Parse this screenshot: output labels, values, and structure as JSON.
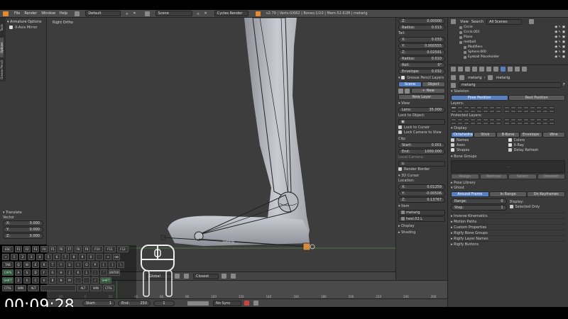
{
  "menu": {
    "items": [
      "File",
      "Render",
      "Window",
      "Help"
    ],
    "layout": "Default",
    "scene": "Scene",
    "engine": "Cycles Render",
    "stats": "v2.79 | Verts:0/682 | Bones:1/10 | Mem:52.61M | metarig"
  },
  "left_tabs": [
    "Tools",
    "Options",
    "Grease Pencil"
  ],
  "armature_options": {
    "title": "Armature Options",
    "xmirror": "X-Axis Mirror"
  },
  "viewport": {
    "view_label": "Right Ortho",
    "bone_label": "metarig"
  },
  "translate": {
    "title": "Translate",
    "vector_label": "Vector",
    "x_label": "X:",
    "x": "0.000",
    "y_label": "Y:",
    "y": "0.000",
    "z_label": "Z:",
    "z": "0.000",
    "constraint_label": "Constraint Axis"
  },
  "keyboard": {
    "rows": [
      [
        "ESC",
        "F1",
        "F2",
        "F3",
        "F4",
        "F5",
        "F6",
        "F7",
        "F8",
        "F9",
        "F10",
        "F11",
        "F12"
      ],
      [
        "~",
        "1",
        "2",
        "3",
        "4",
        "5",
        "6",
        "7",
        "8",
        "9",
        "0",
        "-",
        "+",
        "⌫"
      ],
      [
        "TAB",
        "Q",
        "W",
        "E",
        "R",
        "T",
        "Y",
        "U",
        "I",
        "O",
        "P",
        "[",
        "]",
        "\\"
      ],
      [
        "CAPS",
        "A",
        "S",
        "D",
        "F",
        "G",
        "H",
        "J",
        "K",
        "L",
        ";",
        "'",
        "ENTER"
      ],
      [
        "SHIFT",
        "Z",
        "X",
        "C",
        "V",
        "B",
        "N",
        "M",
        ",",
        ".",
        "/",
        "SHIFT"
      ],
      [
        "CTRL",
        "WIN",
        "ALT",
        "",
        "ALT",
        "WIN",
        "CTRL"
      ]
    ]
  },
  "header3d": {
    "pivot": "Global",
    "snap": "Closest"
  },
  "timeline": {
    "ticks": [
      "-20",
      "0",
      "20",
      "40",
      "60",
      "80",
      "100",
      "120",
      "140",
      "160",
      "180",
      "200",
      "220",
      "240",
      "260"
    ],
    "start_label": "Start:",
    "start": "1",
    "end_label": "End:",
    "end": "250",
    "frame": "1",
    "sync": "No Sync"
  },
  "timer": "00:09:28",
  "npanel": {
    "top_fields": [
      {
        "label": "Z:",
        "value": "0.00000"
      },
      {
        "label": "Radius:",
        "value": "0.013"
      },
      {
        "label": "Tail:",
        "value": ""
      },
      {
        "label": "X:",
        "value": "0.033"
      },
      {
        "label": "Y:",
        "value": "0.000555"
      },
      {
        "label": "Z:",
        "value": "0.02591"
      },
      {
        "label": "Radius:",
        "value": "0.010"
      },
      {
        "label": "Roll:",
        "value": "0°"
      },
      {
        "label": "Envelope:",
        "value": "0.032"
      }
    ],
    "grease_pencil": "Grease Pencil Layers",
    "gp_scene": "Scene",
    "gp_object": "Object",
    "gp_new": "New",
    "gp_new_layer": "New Layer",
    "view": "View",
    "lens_label": "Lens:",
    "lens": "35.000",
    "lock_object": "Lock to Object:",
    "lock_cursor": "Lock to Cursor",
    "lock_camera": "Lock Camera to View",
    "clip": "Clip:",
    "clip_start_label": "Start:",
    "clip_start": "0.001",
    "clip_end_label": "End:",
    "clip_end": "1000.000",
    "local_camera": "Local Camera:",
    "render_border": "Render Border",
    "cursor3d": "3D Cursor",
    "location": "Location:",
    "cx_label": "X:",
    "cx": "0.01259",
    "cy_label": "Y:",
    "cy": "-0.00506",
    "cz_label": "Z:",
    "cz": "0.13767",
    "item": "Item",
    "item_name": "metarig",
    "item_bone": "heel.02.L",
    "display": "Display",
    "shading": "Shading"
  },
  "outliner": {
    "view": "View",
    "search": "Search",
    "scenes": "All Scenes",
    "items": [
      "Circle",
      "Circle.001",
      "Plane",
      "metball",
      "Modifiers",
      "Sphere.000",
      "Eyeball Placeholder"
    ]
  },
  "props": {
    "breadcrumb_obj": "metarig",
    "breadcrumb_bone": "metarig",
    "name": "metarig",
    "skeleton": "Skeleton",
    "pose_position": "Pose Position",
    "rest_position": "Rest Position",
    "layers": "Layers:",
    "protected_layers": "Protected Layers:",
    "display": "Display",
    "display_tabs": [
      "Octahedral",
      "Stick",
      "B-Bone",
      "Envelope",
      "Wire"
    ],
    "names": "Names",
    "axes": "Axes",
    "shapes": "Shapes",
    "colors": "Colors",
    "xray": "X-Ray",
    "delay": "Delay Refresh",
    "bone_groups": "Bone Groups",
    "bg_buttons": [
      "Assign",
      "Remove",
      "Select",
      "Deselect"
    ],
    "pose_library": "Pose Library",
    "ghost": "Ghost",
    "ghost_tabs": [
      "Around Frame",
      "In Range",
      "On Keyframes"
    ],
    "range_label": "Range:",
    "range": "0",
    "step_label": "Step:",
    "step": "1",
    "ghost_display": "Display:",
    "selected_only": "Selected Only",
    "sections": [
      "Inverse Kinematics",
      "Motion Paths",
      "Custom Properties",
      "Rigify Bone Groups",
      "Rigify Layer Names",
      "Rigify Buttons"
    ]
  },
  "colors": {
    "accent": "#5680c2",
    "bg": "#393939",
    "viewport": "#3d3d3d"
  }
}
